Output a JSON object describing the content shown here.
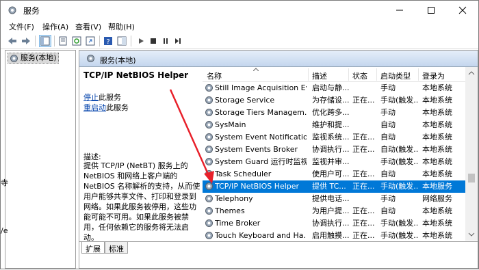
{
  "window": {
    "title": "服务"
  },
  "menu": [
    "文件(F)",
    "操作(A)",
    "查看(V)",
    "帮助(H)"
  ],
  "tree": {
    "item": "服务(本地)"
  },
  "left_cut_text": {
    "a": "寺",
    "b": "/e"
  },
  "panel": {
    "title": "服务(本地)"
  },
  "desc": {
    "service": "TCP/IP NetBIOS Helper",
    "stop_link": "停止",
    "stop_rest": "此服务",
    "restart_link": "重启动",
    "restart_rest": "此服务",
    "label": "描述:",
    "text": "提供 TCP/IP (NetBT) 服务上的 NetBIOS 和网络上客户端的 NetBIOS 名称解析的支持，从而使用户能够共享文件、打印和登录到网络。如果此服务被停用，这些功能可能不可用。如果此服务被禁用，任何依赖它的服务将无法启动。"
  },
  "columns": {
    "name": "名称",
    "desc": "描述",
    "status": "状态",
    "startup": "启动类型",
    "logon": "登录为"
  },
  "rows": [
    {
      "name": "Still Image Acquisition Ev...",
      "desc": "启动与静...",
      "status": "",
      "startup": "手动",
      "logon": "本地系统"
    },
    {
      "name": "Storage Service",
      "desc": "为存储设...",
      "status": "正在...",
      "startup": "手动(触发...",
      "logon": "本地系统"
    },
    {
      "name": "Storage Tiers Managem...",
      "desc": "优化跨多...",
      "status": "",
      "startup": "手动",
      "logon": "本地系统"
    },
    {
      "name": "SysMain",
      "desc": "维护和提...",
      "status": "",
      "startup": "自动",
      "logon": "本地系统"
    },
    {
      "name": "System Event Notification...",
      "desc": "监视系统...",
      "status": "正在...",
      "startup": "自动",
      "logon": "本地系统"
    },
    {
      "name": "System Events Broker",
      "desc": "协调执行...",
      "status": "正在...",
      "startup": "自动(触发...",
      "logon": "本地系统"
    },
    {
      "name": "System Guard 运行时监视...",
      "desc": "监视并审...",
      "status": "",
      "startup": "手动(触发...",
      "logon": "本地系统"
    },
    {
      "name": "Task Scheduler",
      "desc": "使用户可...",
      "status": "正在...",
      "startup": "自动",
      "logon": "本地系统"
    },
    {
      "name": "TCP/IP NetBIOS Helper",
      "desc": "提供 TC...",
      "status": "正在...",
      "startup": "手动(触发...",
      "logon": "本地服务"
    },
    {
      "name": "Telephony",
      "desc": "提供电话...",
      "status": "",
      "startup": "手动",
      "logon": "网络服务"
    },
    {
      "name": "Themes",
      "desc": "为用户提...",
      "status": "正在...",
      "startup": "自动",
      "logon": "本地系统"
    },
    {
      "name": "Time Broker",
      "desc": "协调执行...",
      "status": "正在...",
      "startup": "手动(触发...",
      "logon": "本地系统"
    },
    {
      "name": "Touch Keyboard and Ha...",
      "desc": "启用触摸...",
      "status": "正在...",
      "startup": "手动(触发...",
      "logon": "本地系统"
    }
  ],
  "selected_row": 8,
  "tabs": {
    "extended": "扩展",
    "standard": "标准"
  },
  "colors": {
    "accent": "#0078d7",
    "annotation_arrow": "#e8202a",
    "link": "#0645ad"
  }
}
